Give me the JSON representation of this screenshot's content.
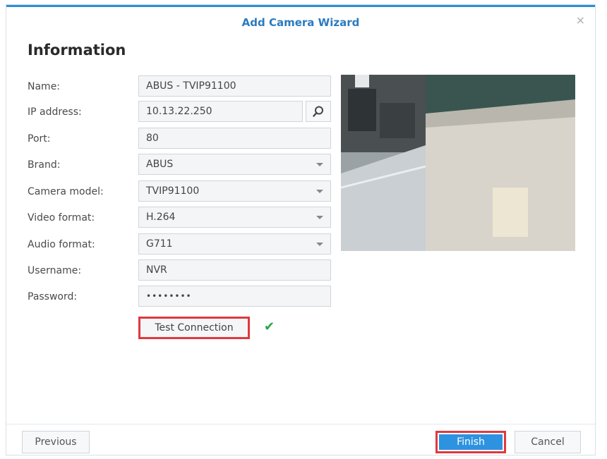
{
  "dialog": {
    "title": "Add Camera Wizard",
    "section_title": "Information",
    "close_glyph": "×"
  },
  "form": {
    "fields": [
      {
        "label": "Name:",
        "value": "ABUS - TVIP91100",
        "type": "text"
      },
      {
        "label": "IP address:",
        "value": "10.13.22.250",
        "type": "text-with-search"
      },
      {
        "label": "Port:",
        "value": "80",
        "type": "text"
      },
      {
        "label": "Brand:",
        "value": "ABUS",
        "type": "dropdown"
      },
      {
        "label": "Camera model:",
        "value": "TVIP91100",
        "type": "dropdown"
      },
      {
        "label": "Video format:",
        "value": "H.264",
        "type": "dropdown"
      },
      {
        "label": "Audio format:",
        "value": "G711",
        "type": "dropdown"
      },
      {
        "label": "Username:",
        "value": "NVR",
        "type": "text"
      },
      {
        "label": "Password:",
        "value": "••••••••",
        "type": "password"
      }
    ],
    "test_connection_label": "Test Connection",
    "test_status_glyph": "✔"
  },
  "footer": {
    "previous_label": "Previous",
    "finish_label": "Finish",
    "cancel_label": "Cancel"
  },
  "icons": {
    "search": "search-icon",
    "check": "checkmark-icon",
    "dropdown": "chevron-down-icon",
    "close": "close-icon"
  },
  "colors": {
    "title": "#2b7bbf",
    "accent": "#2d93e0",
    "highlight_border": "#e0393e",
    "success": "#28a745"
  }
}
